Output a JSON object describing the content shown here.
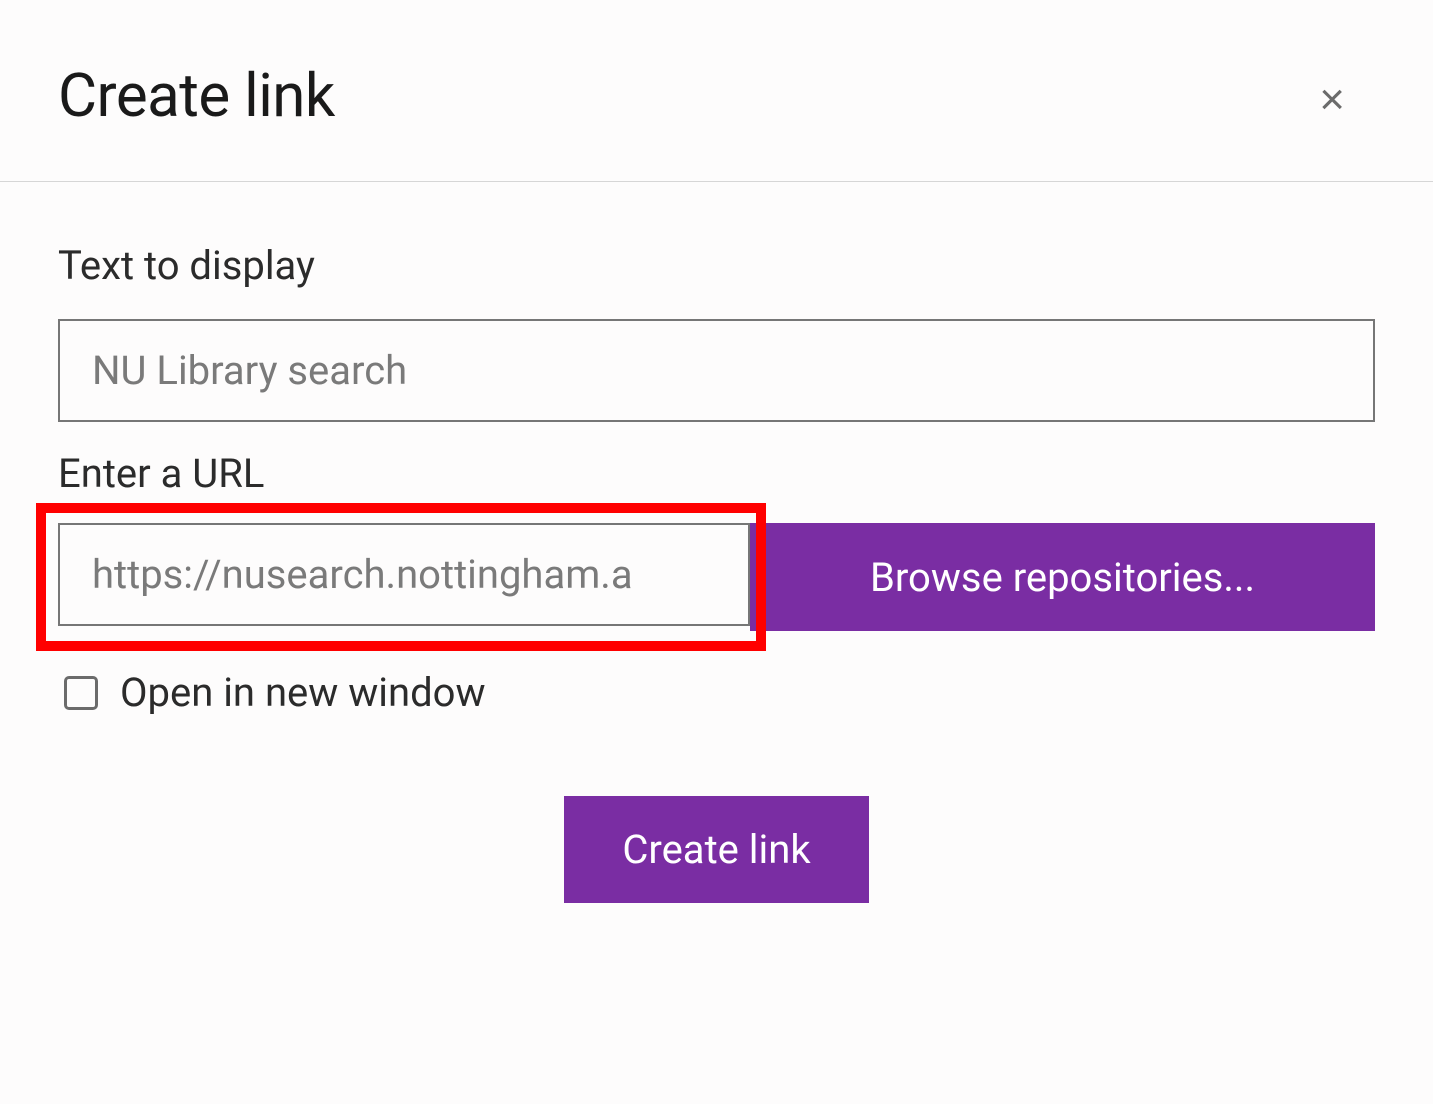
{
  "dialog": {
    "title": "Create link",
    "close_label": "×"
  },
  "form": {
    "text_label": "Text to display",
    "text_value": "NU Library search",
    "url_label": "Enter a URL",
    "url_value": "https://nusearch.nottingham.a",
    "browse_label": "Browse repositories...",
    "checkbox_label": "Open in new window",
    "submit_label": "Create link"
  },
  "colors": {
    "primary": "#7a2da3",
    "highlight": "#ff0000"
  }
}
